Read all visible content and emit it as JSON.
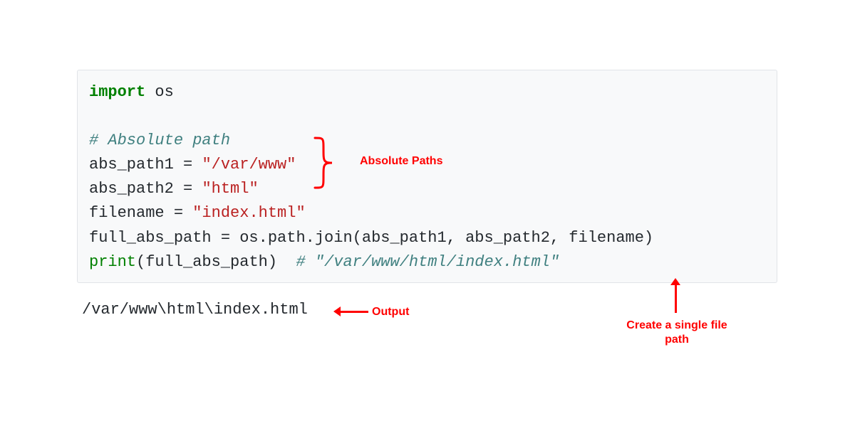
{
  "code": {
    "l1_import": "import",
    "l1_mod": " os",
    "l3_comment": "# Absolute path",
    "l4_pre": "abs_path1 = ",
    "l4_str": "\"/var/www\"",
    "l5_pre": "abs_path2 = ",
    "l5_str": "\"html\"",
    "l6_pre": "filename = ",
    "l6_str": "\"index.html\"",
    "l7": "full_abs_path = os.path.join(abs_path1, abs_path2, filename)",
    "l8_print": "print",
    "l8_args": "(full_abs_path)  ",
    "l8_comment": "# \"/var/www/html/index.html\""
  },
  "output": "/var/www\\html\\index.html",
  "labels": {
    "absolute": "Absolute Paths",
    "output": "Output",
    "single_line1": "Create a single file",
    "single_line2": "path"
  },
  "colors": {
    "annotation": "#ff0000",
    "keyword": "#008000",
    "comment": "#408080",
    "string": "#ba2121",
    "bg": "#f8f9fa"
  }
}
